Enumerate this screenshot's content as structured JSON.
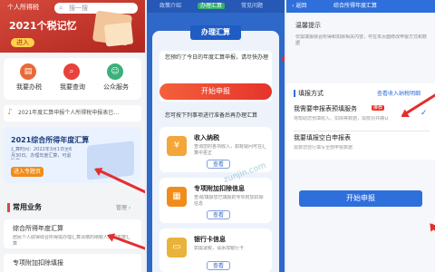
{
  "p1": {
    "tab_personal": "个人所得税",
    "search_placeholder": "搜一搜",
    "banner_title": "2021个税记忆",
    "banner_button": "进入",
    "nav": [
      {
        "label": "我要办税",
        "icon": "doc-icon"
      },
      {
        "label": "我要查询",
        "icon": "search-icon"
      },
      {
        "label": "公众服务",
        "icon": "people-icon"
      }
    ],
    "notice": "2021年度汇算申报个人所得税申报表已…",
    "promo_title": "2021综合所得年度汇算",
    "promo_text": "汇算时间：2022年3月1日至6月30日。办理年度汇算，可退补税。",
    "promo_button": "进入专题页",
    "common_title": "常用业务",
    "common_manage": "管理 ›",
    "common_item_title": "综合所得年度汇算",
    "common_item_desc": "居民个人取得综合所得需办理汇算清缴的纳税人办理年度汇算",
    "bottom_item": "专项附加扣除填报"
  },
  "p2": {
    "tabs": [
      "政策介绍",
      "办理汇算",
      "常见问题"
    ],
    "header_title": "办理汇算",
    "notice1": "您预约了今日的年度汇算申报，请尽快办理",
    "start_button": "开始申报",
    "notice2": "您可按下列事项进行准备后再办理汇算",
    "items": [
      {
        "title": "收入纳税",
        "desc": "查询您的各项收入，如有疑问可在汇算中更正",
        "button": "查看"
      },
      {
        "title": "专项附加扣除信息",
        "desc": "查询/填报您已填报的专项附加扣除信息",
        "button": "查看"
      },
      {
        "title": "银行卡信息",
        "desc": "如需退税，请添加银行卡",
        "button": "查看"
      }
    ],
    "watermark": "zunjin.com"
  },
  "p3": {
    "back": "‹ 返回",
    "title": "综合所得年度汇算",
    "section_tip": "温馨提示",
    "tip_text": "仅需填报综合所得和扣除相关内容，可在本页面修改申报方式和数据",
    "method_label": "填报方式",
    "link_text": "查看收入纳税明细",
    "option1_title": "我需要申报表预填服务",
    "option1_badge": "推荐",
    "option1_desc": "将帮助您预填收入、扣除等数据，需核对并确认",
    "option2_title": "我要填报空白申报表",
    "option2_desc": "需要您自行填写全部申报数据",
    "start_button": "开始申报"
  },
  "colors": {
    "accent_blue": "#2f6fdc",
    "arrow_red": "#e52d2d",
    "orange": "#f08c1a",
    "check": "#2f6fdc"
  }
}
